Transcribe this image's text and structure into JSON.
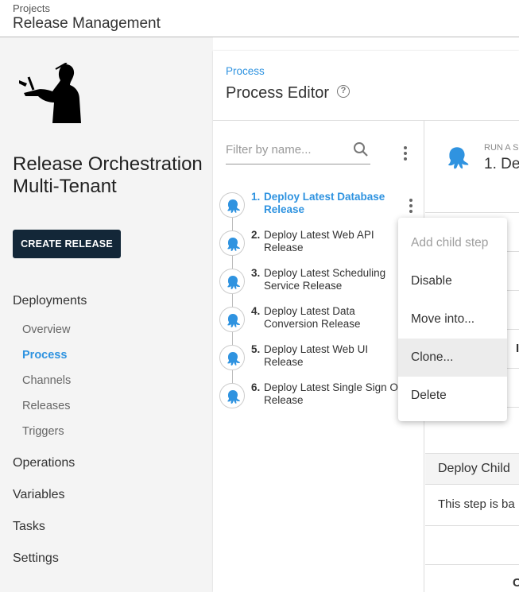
{
  "header": {
    "breadcrumb": "Projects",
    "project": "Release Management"
  },
  "sidebar": {
    "project_name": "Release Orchestration Multi-Tenant",
    "create_release": "CREATE RELEASE",
    "deployments": "Deployments",
    "sub_items": [
      "Overview",
      "Process",
      "Channels",
      "Releases",
      "Triggers"
    ],
    "active_item": "Process",
    "top_items": [
      "Operations",
      "Variables",
      "Tasks",
      "Settings"
    ]
  },
  "main": {
    "breadcrumb": "Process",
    "title": "Process Editor",
    "help_icon": "?",
    "filter_placeholder": "Filter by name...",
    "steps": [
      {
        "number": "1.",
        "name": "Deploy Latest Database Release",
        "selected": true
      },
      {
        "number": "2.",
        "name": "Deploy Latest Web API Release",
        "selected": false
      },
      {
        "number": "3.",
        "name": "Deploy Latest Scheduling Service Release",
        "selected": false
      },
      {
        "number": "4.",
        "name": "Deploy Latest Data Conversion Release",
        "selected": false
      },
      {
        "number": "5.",
        "name": "Deploy Latest Web UI Release",
        "selected": false
      },
      {
        "number": "6.",
        "name": "Deploy Latest Single Sign On Release",
        "selected": false
      }
    ]
  },
  "detail": {
    "run_label": "RUN A S",
    "title": "1. De",
    "section_title": "Deploy Child",
    "section_text": "This step is ba",
    "mark_a": "I",
    "mark_b": "C"
  },
  "context_menu": {
    "items": [
      {
        "label": "Add child step",
        "state": "disabled"
      },
      {
        "label": "Disable",
        "state": "normal"
      },
      {
        "label": "Move into...",
        "state": "normal"
      },
      {
        "label": "Clone...",
        "state": "hover"
      },
      {
        "label": "Delete",
        "state": "normal"
      }
    ]
  },
  "colors": {
    "accent": "#2f93e0",
    "dark_button": "#132738",
    "sidebar_bg": "#f4f4f4"
  },
  "icons": [
    "octopus-icon",
    "search-icon",
    "kebab-menu-icon",
    "help-icon",
    "conductor-logo"
  ]
}
